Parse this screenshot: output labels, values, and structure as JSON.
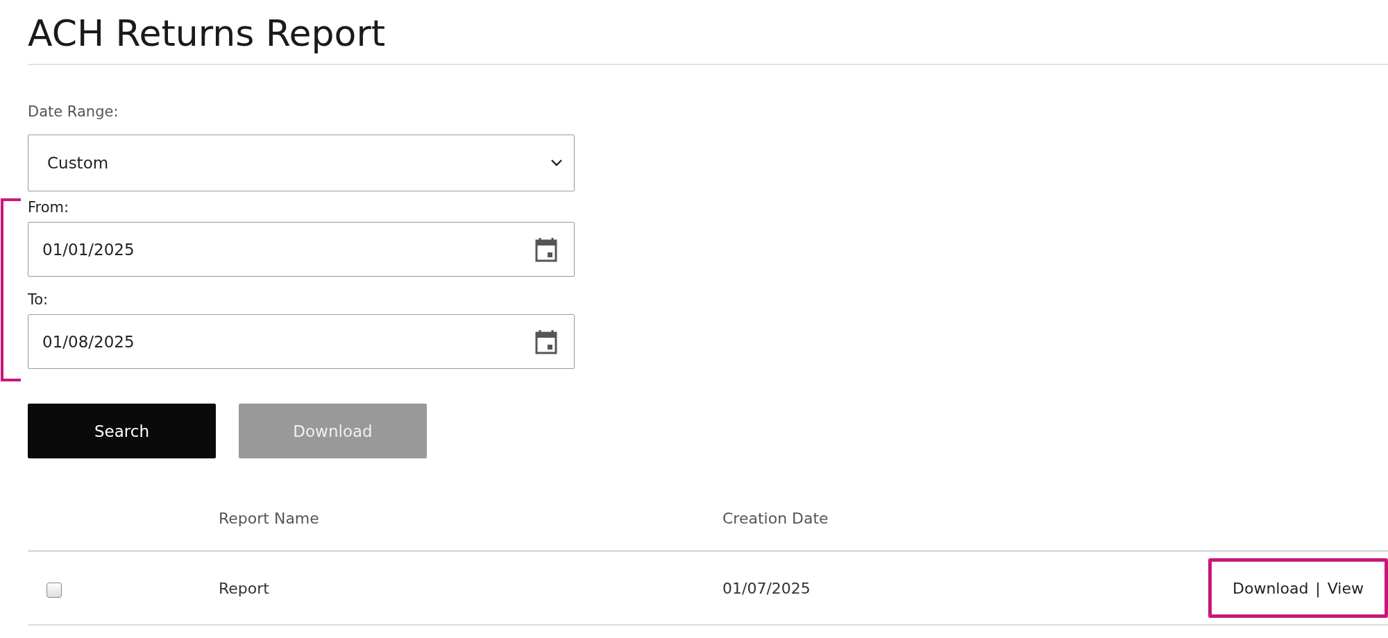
{
  "page": {
    "title": "ACH Returns Report"
  },
  "filters": {
    "date_range": {
      "label": "Date Range:",
      "value": "Custom"
    },
    "from": {
      "label": "From:",
      "value": "01/01/2025"
    },
    "to": {
      "label": "To:",
      "value": "01/08/2025"
    }
  },
  "buttons": [
    {
      "label": "Search",
      "kind": "primary",
      "disabled": false
    },
    {
      "label": "Download",
      "kind": "secondary",
      "disabled": true
    }
  ],
  "table": {
    "columns": [
      "Report Name",
      "Creation Date"
    ],
    "rows": [
      {
        "checked": false,
        "name": "Report",
        "date": "01/07/2025",
        "actions": [
          {
            "label": "Download"
          },
          {
            "label": "View"
          }
        ],
        "separator": "|",
        "highlighted": true
      }
    ]
  },
  "annotations": {
    "bracket": true
  }
}
